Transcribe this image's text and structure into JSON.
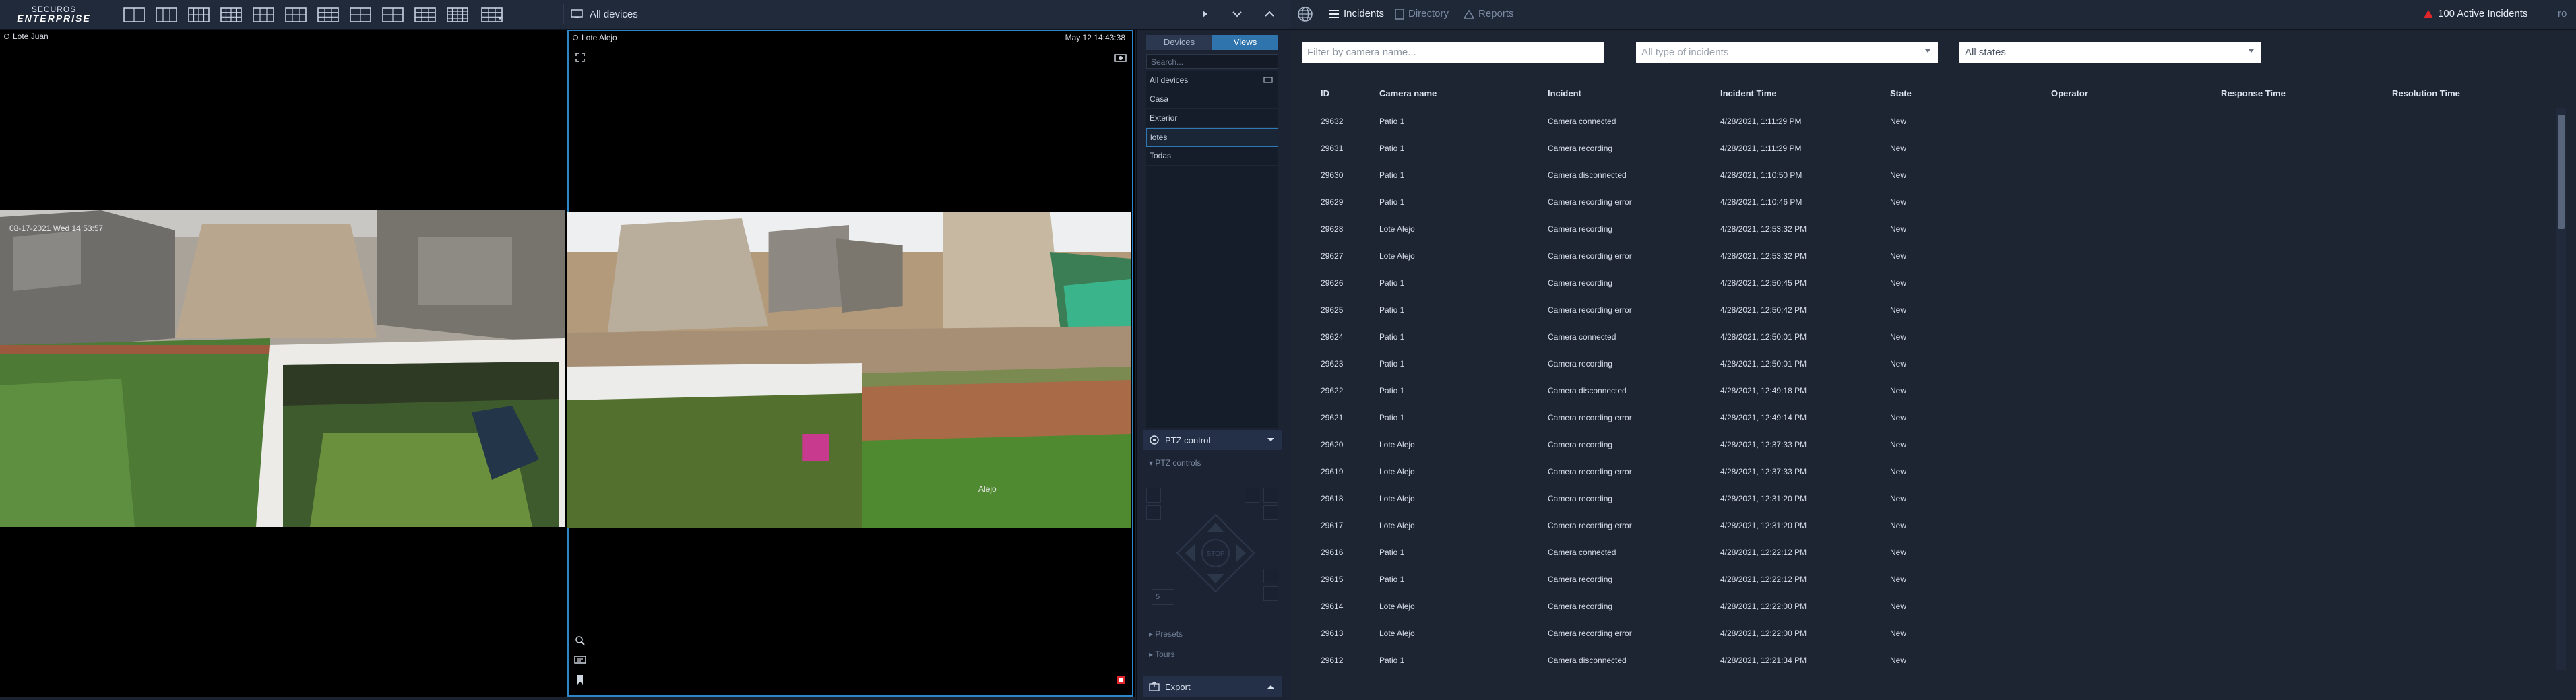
{
  "brand": {
    "line1": "SECUROS",
    "line2": "ENTERPRISE"
  },
  "toolbar": {
    "layout_icons": [
      "layout-1x2-icon",
      "layout-1x3-icon",
      "layout-2x4-icon",
      "layout-grid-icon",
      "layout-2x3-icon",
      "layout-mixed-icon",
      "layout-mixed2-icon",
      "layout-2x2-icon",
      "layout-2x2b-icon",
      "layout-3x3-icon",
      "layout-4x4-icon",
      "layout-dropdown-icon"
    ],
    "devices_label": "All devices"
  },
  "cameras": [
    {
      "name": "Lote Juan",
      "timestamp": "",
      "osd_overlay": "08-17-2021 Wed 14:53:57"
    },
    {
      "name": "Lote Alejo",
      "timestamp": "May 12 14:43:38",
      "osd_overlay": "Alejo"
    }
  ],
  "side_panel": {
    "tabs": [
      {
        "label": "Devices",
        "active": false
      },
      {
        "label": "Views",
        "active": true
      }
    ],
    "search_placeholder": "Search...",
    "views": [
      {
        "label": "All devices",
        "selected": false
      },
      {
        "label": "Casa",
        "selected": false
      },
      {
        "label": "Exterior",
        "selected": false
      },
      {
        "label": "lotes",
        "selected": true
      },
      {
        "label": "Todas",
        "selected": false
      }
    ],
    "ptz_title": "PTZ control",
    "ptz_subtitle": "PTZ controls",
    "ptz_center": "STOP",
    "ptz_speed": "5",
    "presets_label": "Presets",
    "tours_label": "Tours",
    "export_title": "Export"
  },
  "incidents_panel": {
    "nav": {
      "incidents": "Incidents",
      "directory": "Directory",
      "reports": "Reports"
    },
    "active_count_label": "100 Active Incidents",
    "user_stub": "ro",
    "filters": {
      "camera_placeholder": "Filter by camera name...",
      "type_value": "All type of incidents",
      "state_value": "All states"
    },
    "columns": [
      "ID",
      "Camera name",
      "Incident",
      "Incident Time",
      "State",
      "Operator",
      "Response Time",
      "Resolution Time"
    ],
    "rows": [
      [
        "29632",
        "Patio 1",
        "Camera connected",
        "4/28/2021, 1:11:29 PM",
        "New"
      ],
      [
        "29631",
        "Patio 1",
        "Camera recording",
        "4/28/2021, 1:11:29 PM",
        "New"
      ],
      [
        "29630",
        "Patio 1",
        "Camera disconnected",
        "4/28/2021, 1:10:50 PM",
        "New"
      ],
      [
        "29629",
        "Patio 1",
        "Camera recording error",
        "4/28/2021, 1:10:46 PM",
        "New"
      ],
      [
        "29628",
        "Lote Alejo",
        "Camera recording",
        "4/28/2021, 12:53:32 PM",
        "New"
      ],
      [
        "29627",
        "Lote Alejo",
        "Camera recording error",
        "4/28/2021, 12:53:32 PM",
        "New"
      ],
      [
        "29626",
        "Patio 1",
        "Camera recording",
        "4/28/2021, 12:50:45 PM",
        "New"
      ],
      [
        "29625",
        "Patio 1",
        "Camera recording error",
        "4/28/2021, 12:50:42 PM",
        "New"
      ],
      [
        "29624",
        "Patio 1",
        "Camera connected",
        "4/28/2021, 12:50:01 PM",
        "New"
      ],
      [
        "29623",
        "Patio 1",
        "Camera recording",
        "4/28/2021, 12:50:01 PM",
        "New"
      ],
      [
        "29622",
        "Patio 1",
        "Camera disconnected",
        "4/28/2021, 12:49:18 PM",
        "New"
      ],
      [
        "29621",
        "Patio 1",
        "Camera recording error",
        "4/28/2021, 12:49:14 PM",
        "New"
      ],
      [
        "29620",
        "Lote Alejo",
        "Camera recording",
        "4/28/2021, 12:37:33 PM",
        "New"
      ],
      [
        "29619",
        "Lote Alejo",
        "Camera recording error",
        "4/28/2021, 12:37:33 PM",
        "New"
      ],
      [
        "29618",
        "Lote Alejo",
        "Camera recording",
        "4/28/2021, 12:31:20 PM",
        "New"
      ],
      [
        "29617",
        "Lote Alejo",
        "Camera recording error",
        "4/28/2021, 12:31:20 PM",
        "New"
      ],
      [
        "29616",
        "Patio 1",
        "Camera connected",
        "4/28/2021, 12:22:12 PM",
        "New"
      ],
      [
        "29615",
        "Patio 1",
        "Camera recording",
        "4/28/2021, 12:22:12 PM",
        "New"
      ],
      [
        "29614",
        "Lote Alejo",
        "Camera recording",
        "4/28/2021, 12:22:00 PM",
        "New"
      ],
      [
        "29613",
        "Lote Alejo",
        "Camera recording error",
        "4/28/2021, 12:22:00 PM",
        "New"
      ],
      [
        "29612",
        "Patio 1",
        "Camera disconnected",
        "4/28/2021, 12:21:34 PM",
        "New"
      ]
    ]
  },
  "colors": {
    "accent": "#2f74ad",
    "alert": "#e0262b",
    "panel_bg": "#1d2533",
    "selection": "#2d86c8"
  }
}
